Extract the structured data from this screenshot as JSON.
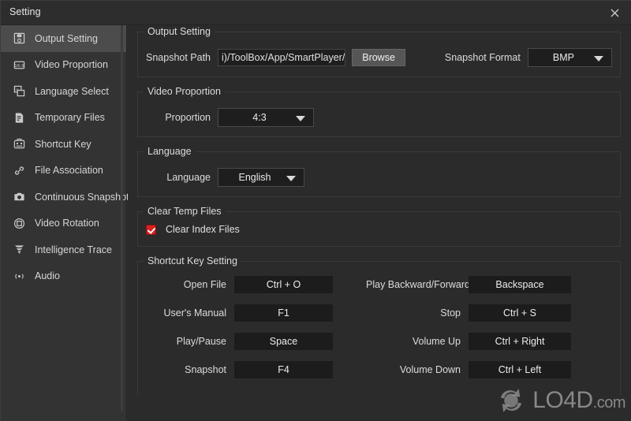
{
  "window": {
    "title": "Setting",
    "close_icon": "close-icon"
  },
  "sidebar": {
    "items": [
      {
        "label": "Output Setting",
        "icon": "floppy-disk-icon",
        "active": true
      },
      {
        "label": "Video Proportion",
        "icon": "aspect-ratio-icon",
        "active": false
      },
      {
        "label": "Language Select",
        "icon": "language-icon",
        "active": false
      },
      {
        "label": "Temporary Files",
        "icon": "document-icon",
        "active": false
      },
      {
        "label": "Shortcut Key",
        "icon": "keyboard-icon",
        "active": false
      },
      {
        "label": "File Association",
        "icon": "link-icon",
        "active": false
      },
      {
        "label": "Continuous Snapshot",
        "icon": "camera-icon",
        "active": false
      },
      {
        "label": "Video Rotation",
        "icon": "rotation-icon",
        "active": false
      },
      {
        "label": "Intelligence Trace",
        "icon": "trace-icon",
        "active": false
      },
      {
        "label": "Audio",
        "icon": "audio-wave-icon",
        "active": false
      }
    ]
  },
  "output_setting": {
    "legend": "Output Setting",
    "snapshot_path_label": "Snapshot Path",
    "snapshot_path_value": "i)/ToolBox/App/SmartPlayer/Pictures/",
    "browse_label": "Browse",
    "snapshot_format_label": "Snapshot Format",
    "snapshot_format_value": "BMP"
  },
  "video_proportion": {
    "legend": "Video Proportion",
    "proportion_label": "Proportion",
    "proportion_value": "4:3"
  },
  "language": {
    "legend": "Language",
    "language_label": "Language",
    "language_value": "English"
  },
  "clear_temp_files": {
    "legend": "Clear Temp Files",
    "clear_index_label": "Clear Index Files",
    "clear_index_checked": true,
    "checkbox_color": "#d91f1f"
  },
  "shortcut_key_setting": {
    "legend": "Shortcut Key Setting",
    "rows": [
      {
        "left_label": "Open File",
        "left_value": "Ctrl + O",
        "right_label": "Play Backward/Forward",
        "right_value": "Backspace"
      },
      {
        "left_label": "User's Manual",
        "left_value": "F1",
        "right_label": "Stop",
        "right_value": "Ctrl + S"
      },
      {
        "left_label": "Play/Pause",
        "left_value": "Space",
        "right_label": "Volume Up",
        "right_value": "Ctrl + Right"
      },
      {
        "left_label": "Snapshot",
        "left_value": "F4",
        "right_label": "Volume Down",
        "right_value": "Ctrl + Left"
      }
    ]
  },
  "watermark": {
    "text": "LO4D",
    "domain": ".com"
  }
}
